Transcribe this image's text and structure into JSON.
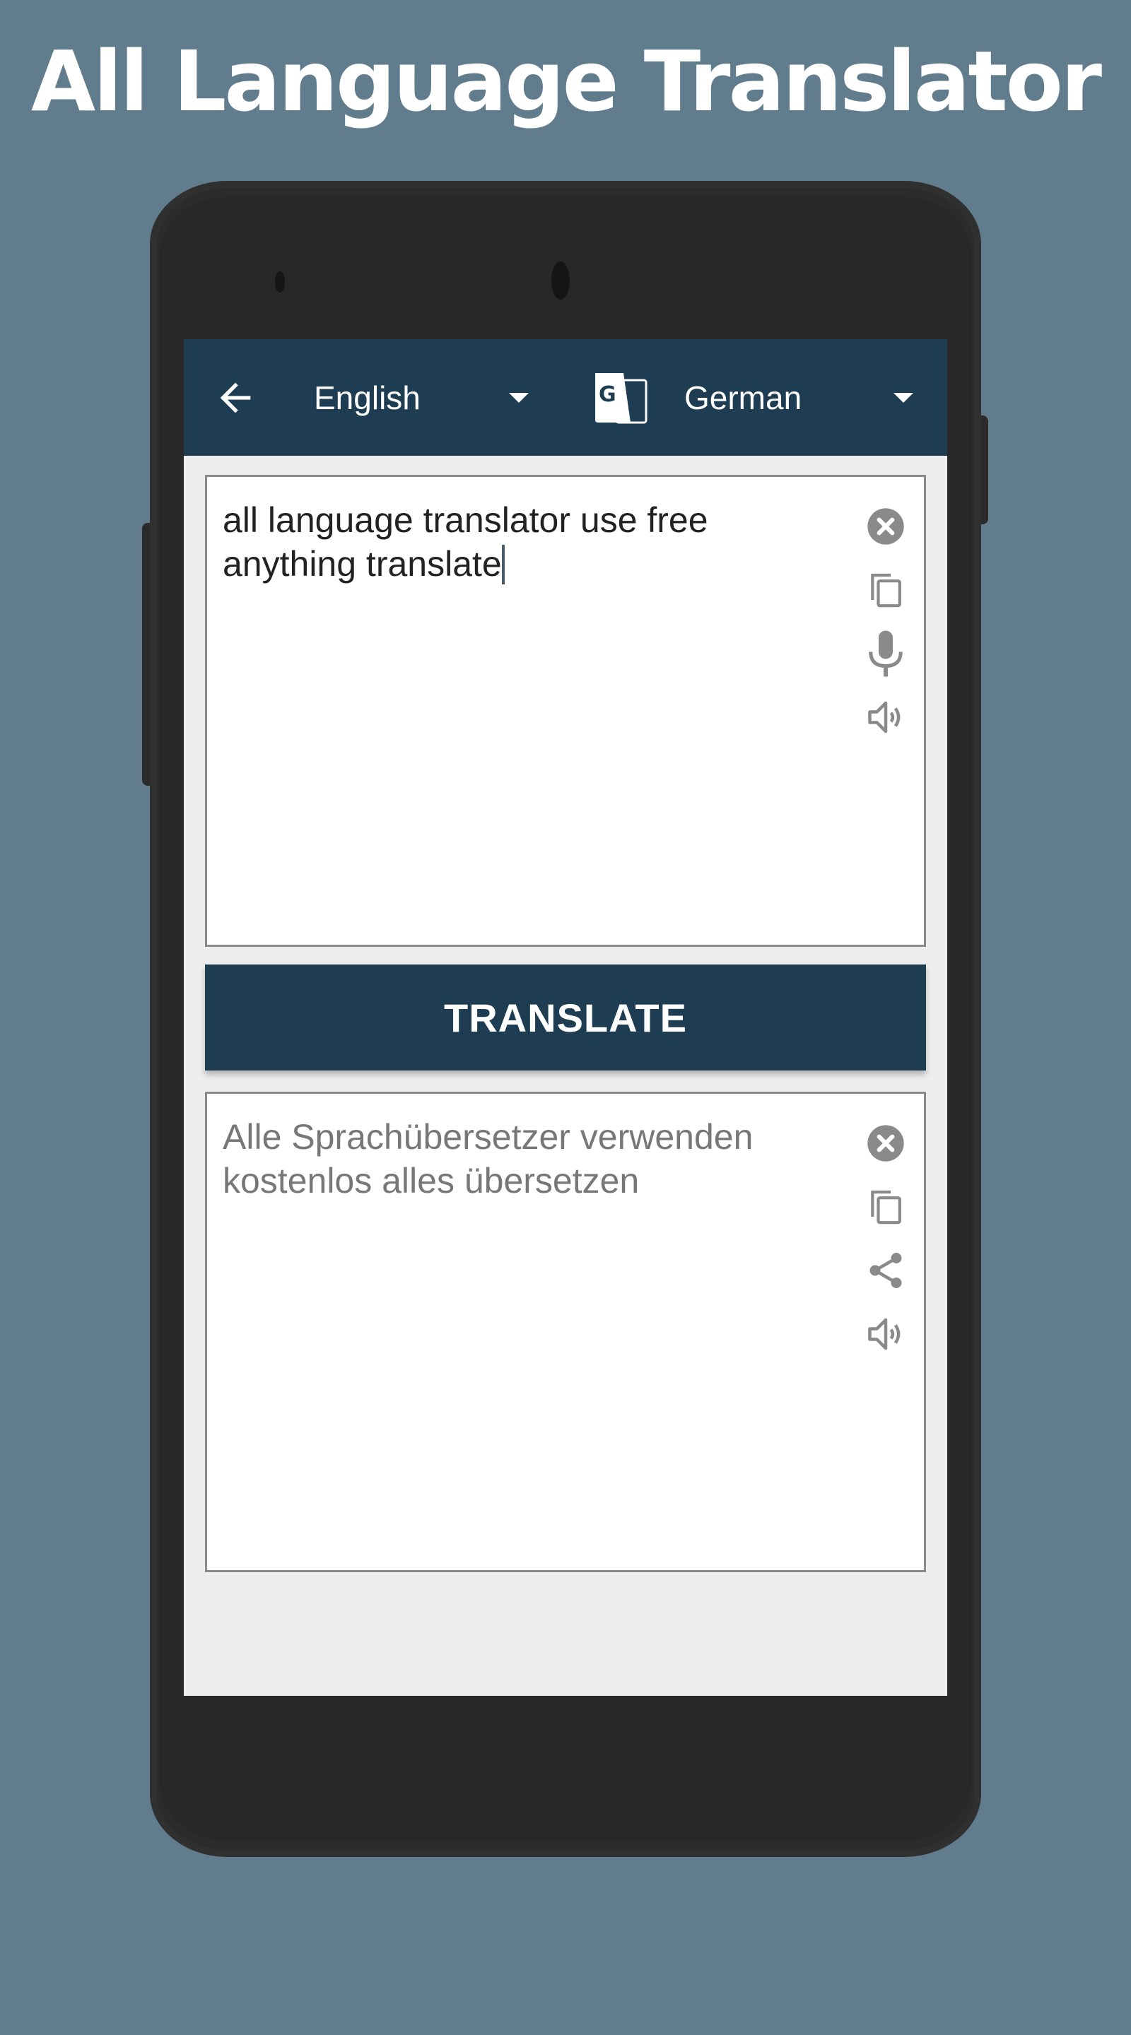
{
  "promo": {
    "title": "All Language Translator"
  },
  "app_bar": {
    "back_icon": "arrow-left-icon",
    "source_language": "English",
    "target_language": "German",
    "swap_icon": "google-translate-icon",
    "dropdown_icon": "caret-down-icon"
  },
  "input_card": {
    "text": "all language translator use free anything translate",
    "icons": [
      "clear-icon",
      "copy-icon",
      "microphone-icon",
      "speaker-icon"
    ]
  },
  "translate_button": {
    "label": "TRANSLATE"
  },
  "output_card": {
    "text": "Alle Sprachübersetzer verwenden kostenlos alles übersetzen",
    "icons": [
      "clear-icon",
      "copy-icon",
      "share-icon",
      "speaker-icon"
    ]
  },
  "colors": {
    "background": "#617d8d",
    "primary": "#1e3d52",
    "screen_bg": "#eeeeee",
    "icon_gray": "#8a8a8a",
    "phone_body": "#282828"
  }
}
